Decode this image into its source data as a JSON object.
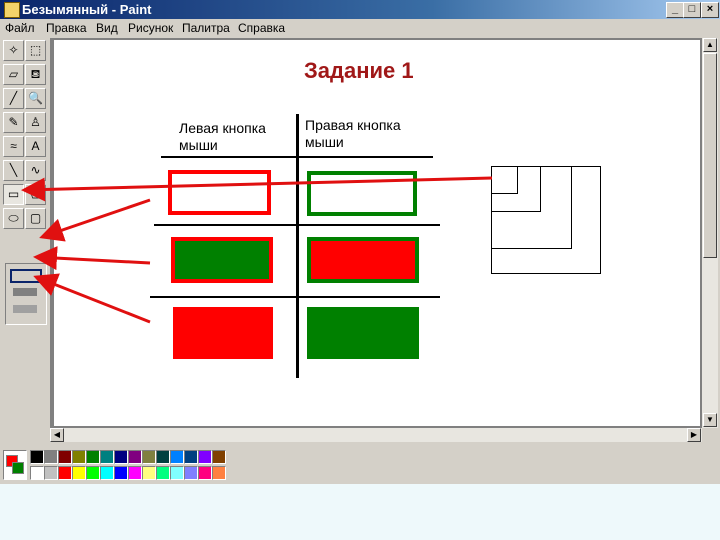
{
  "window": {
    "title": "Безымянный - Paint"
  },
  "titlebar_buttons": {
    "minimize": "_",
    "maximize": "□",
    "close": "×"
  },
  "menu": [
    "Файл",
    "Правка",
    "Вид",
    "Рисунок",
    "Палитра",
    "Справка"
  ],
  "tools": [
    {
      "name": "free-select-icon",
      "glyph": "✧"
    },
    {
      "name": "rect-select-icon",
      "glyph": "⬚"
    },
    {
      "name": "eraser-icon",
      "glyph": "▱"
    },
    {
      "name": "fill-icon",
      "glyph": "⛾"
    },
    {
      "name": "pick-color-icon",
      "glyph": "╱"
    },
    {
      "name": "magnifier-icon",
      "glyph": "🔍"
    },
    {
      "name": "pencil-icon",
      "glyph": "✎"
    },
    {
      "name": "brush-icon",
      "glyph": "♙"
    },
    {
      "name": "airbrush-icon",
      "glyph": "≈"
    },
    {
      "name": "text-icon",
      "glyph": "A"
    },
    {
      "name": "line-icon",
      "glyph": "╲"
    },
    {
      "name": "curve-icon",
      "glyph": "∿"
    },
    {
      "name": "rectangle-icon",
      "glyph": "▭"
    },
    {
      "name": "polygon-icon",
      "glyph": "⬠"
    },
    {
      "name": "ellipse-icon",
      "glyph": "⬭"
    },
    {
      "name": "rounded-rect-icon",
      "glyph": "▢"
    }
  ],
  "canvas": {
    "title": "Задание 1",
    "col_left": [
      "Левая кнопка",
      "мыши"
    ],
    "col_right": [
      "Правая кнопка",
      "мыши"
    ]
  },
  "colors": {
    "red": "#ff0000",
    "green": "#008000",
    "title_red": "#a01818"
  },
  "palette": [
    "#000000",
    "#808080",
    "#800000",
    "#808000",
    "#008000",
    "#008080",
    "#000080",
    "#800080",
    "#808040",
    "#004040",
    "#0080ff",
    "#004080",
    "#8000ff",
    "#804000",
    "#ffffff",
    "#c0c0c0",
    "#ff0000",
    "#ffff00",
    "#00ff00",
    "#00ffff",
    "#0000ff",
    "#ff00ff",
    "#ffff80",
    "#00ff80",
    "#80ffff",
    "#8080ff",
    "#ff0080",
    "#ff8040"
  ]
}
